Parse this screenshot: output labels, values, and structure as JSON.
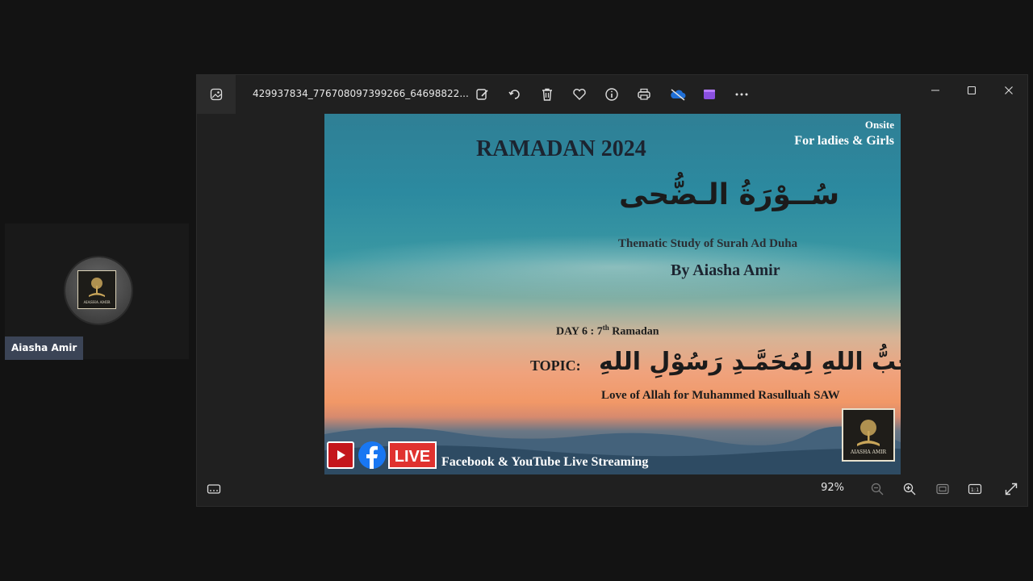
{
  "participant": {
    "name": "Aiasha Amir",
    "logo_text": "AIASHA AMIR"
  },
  "window": {
    "filename": "429937834_776708097399266_64698822...",
    "toolbar": [
      "edit-icon",
      "rotate-icon",
      "delete-icon",
      "favorite-icon",
      "info-icon",
      "print-icon",
      "onedrive-icon",
      "clipchamp-icon",
      "more-icon"
    ],
    "zoom": "92%"
  },
  "poster": {
    "title": "RAMADAN 2024",
    "onsite": "Onsite",
    "audience": "For ladies & Girls",
    "arabic_title": "سُــوْرَةُ الـضُّحى",
    "subtitle": "Thematic Study of Surah Ad Duha",
    "author": "By Aiasha Amir",
    "day": "DAY 6",
    "day_sep": " : 7",
    "day_sup": "th",
    "day_suffix": " Ramadan",
    "topic_label": "TOPIC:",
    "topic_arabic": "حُبُّ اللهِ لِمُحَمَّـدِ رَسُوْلِ اللهِ",
    "topic_english": "Love of Allah for Muhammed Rasulluah SAW",
    "live_label": "LIVE",
    "streaming": "Facebook & YouTube Live Streaming",
    "logo_text": "AIASHA AMIR"
  }
}
